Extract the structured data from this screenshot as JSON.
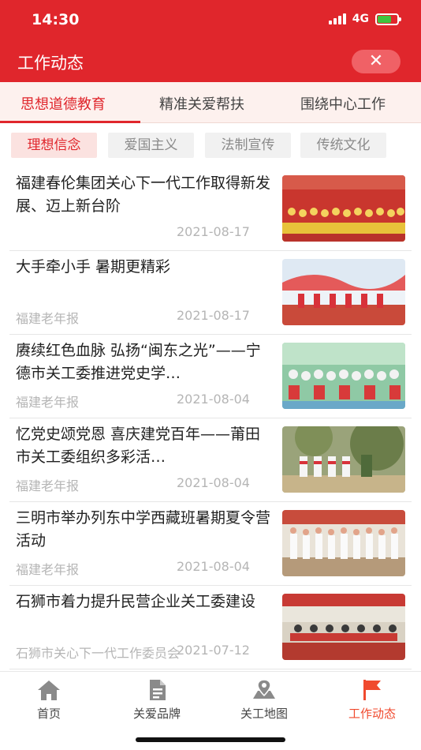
{
  "status_bar": {
    "time": "14:30",
    "network": "4G"
  },
  "header": {
    "title": "工作动态",
    "close_icon": "close-icon"
  },
  "tabs": [
    {
      "label": "思想道德教育",
      "active": true
    },
    {
      "label": "精准关爱帮扶",
      "active": false
    },
    {
      "label": "围绕中心工作",
      "active": false
    }
  ],
  "filters": [
    {
      "label": "理想信念",
      "active": true
    },
    {
      "label": "爱国主义",
      "active": false
    },
    {
      "label": "法制宣传",
      "active": false
    },
    {
      "label": "传统文化",
      "active": false
    }
  ],
  "articles": [
    {
      "title": "福建春伦集团关心下一代工作取得新发展、迈上新台阶",
      "source": "",
      "date": "2021-08-17"
    },
    {
      "title": "大手牵小手 暑期更精彩",
      "source": "福建老年报",
      "date": "2021-08-17"
    },
    {
      "title": "赓续红色血脉 弘扬“闽东之光”——宁德市关工委推进党史学…",
      "source": "福建老年报",
      "date": "2021-08-04"
    },
    {
      "title": "忆党史颂党恩 喜庆建党百年——莆田市关工委组织多彩活…",
      "source": "福建老年报",
      "date": "2021-08-04"
    },
    {
      "title": "三明市举办列东中学西藏班暑期夏令营活动",
      "source": "福建老年报",
      "date": "2021-08-04"
    },
    {
      "title": "石狮市着力提升民营企业关工委建设",
      "source": "石狮市关心下一代工作委员会",
      "date": "2021-07-12"
    }
  ],
  "bottom_nav": [
    {
      "label": "首页",
      "icon": "home-icon",
      "active": false
    },
    {
      "label": "关爱品牌",
      "icon": "document-icon",
      "active": false
    },
    {
      "label": "关工地图",
      "icon": "map-icon",
      "active": false
    },
    {
      "label": "工作动态",
      "icon": "flag-icon",
      "active": true
    }
  ],
  "colors": {
    "brand_red": "#e0262c",
    "active_nav": "#f04a2e",
    "muted_text": "#b5b5b5"
  }
}
